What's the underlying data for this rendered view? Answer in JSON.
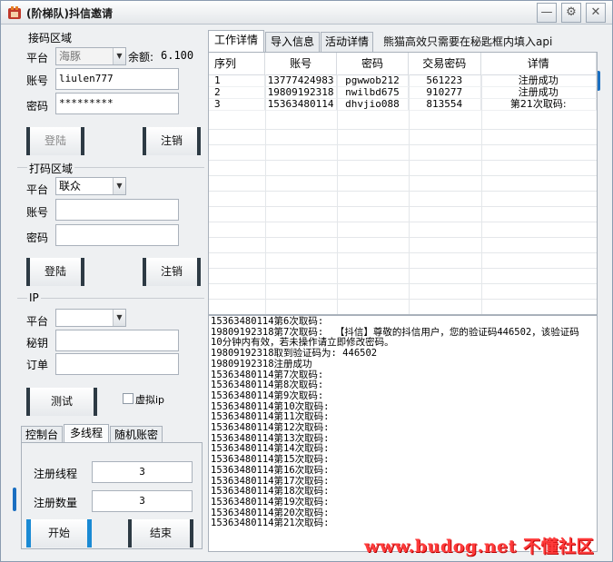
{
  "window": {
    "title": "(阶梯队)抖信邀请",
    "buttons": {
      "minimize": "—",
      "settings": "⚙",
      "close": "✕"
    }
  },
  "receive_section": {
    "title": "接码区域",
    "platform_label": "平台",
    "platform_value": "海豚",
    "balance_label": "余额:",
    "balance_value": "6.100",
    "account_label": "账号",
    "account_value": "liulen777",
    "password_label": "密码",
    "password_value": "*********",
    "login_button": "登陆",
    "logout_button": "注销"
  },
  "captcha_section": {
    "title": "打码区域",
    "platform_label": "平台",
    "platform_value": "联众",
    "account_label": "账号",
    "account_value": "",
    "password_label": "密码",
    "password_value": "",
    "login_button": "登陆",
    "logout_button": "注销"
  },
  "ip_section": {
    "title": "IP",
    "platform_label": "平台",
    "platform_value": "",
    "secret_label": "秘钥",
    "secret_value": "",
    "order_label": "订单",
    "order_value": "",
    "test_button": "测试",
    "virtual_ip_label": "虚拟ip"
  },
  "left_tabs": [
    {
      "label": "控制台"
    },
    {
      "label": "多线程"
    },
    {
      "label": "随机账密"
    }
  ],
  "multithread": {
    "threads_label": "注册线程",
    "threads_value": "3",
    "count_label": "注册数量",
    "count_value": "3",
    "start_button": "开始",
    "stop_button": "结束"
  },
  "right_tabs": [
    {
      "label": "工作详情"
    },
    {
      "label": "导入信息"
    },
    {
      "label": "活动详情"
    }
  ],
  "tab_note": "熊猫高效只需要在秘匙框内填入api",
  "table": {
    "headers": [
      "序列",
      "账号",
      "密码",
      "交易密码",
      "详情"
    ],
    "rows": [
      [
        "1",
        "13777424983",
        "pgwwob212",
        "561223",
        "注册成功"
      ],
      [
        "2",
        "19809192318",
        "nwilbd675",
        "910277",
        "注册成功"
      ],
      [
        "3",
        "15363480114",
        "dhvjio088",
        "813554",
        "第21次取码:"
      ]
    ]
  },
  "log_text": "15363480114第6次取码:\n19809192318第7次取码:  【抖信】尊敬的抖信用户，您的验证码446502，该验证码\n10分钟内有效，若未操作请立即修改密码。\n19809192318取到验证码为: 446502\n19809192318注册成功\n15363480114第7次取码:\n15363480114第8次取码:\n15363480114第9次取码:\n15363480114第10次取码:\n15363480114第11次取码:\n15363480114第12次取码:\n15363480114第13次取码:\n15363480114第14次取码:\n15363480114第15次取码:\n15363480114第16次取码:\n15363480114第17次取码:\n15363480114第18次取码:\n15363480114第19次取码:\n15363480114第20次取码:\n15363480114第21次取码:",
  "watermark": "www.budog.net 不懂社区",
  "colors": {
    "accent": "#1a8ad4",
    "watermark": "#ff3b3b"
  }
}
